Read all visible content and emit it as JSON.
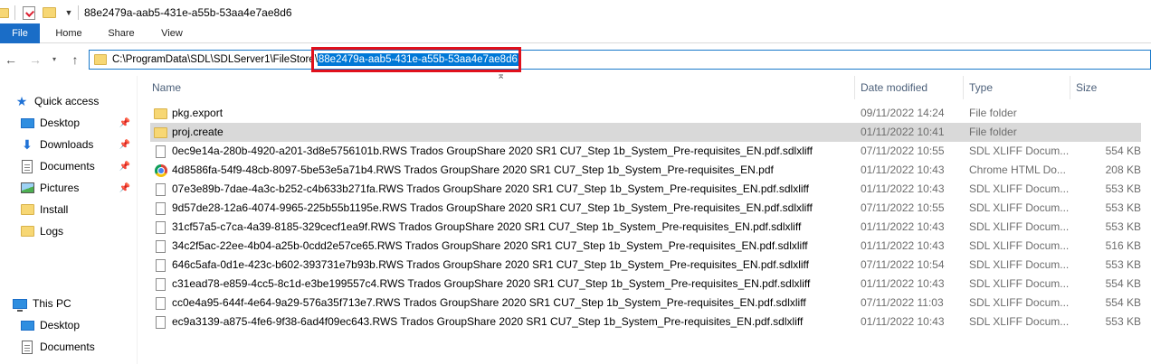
{
  "titlebar": {
    "title": "88e2479a-aab5-431e-a55b-53aa4e7ae8d6",
    "icons": [
      "folder-icon",
      "properties-icon",
      "new-folder-icon",
      "customize-dropdown-icon"
    ]
  },
  "ribbon": {
    "tabs": [
      {
        "label": "File"
      },
      {
        "label": "Home"
      },
      {
        "label": "Share"
      },
      {
        "label": "View"
      }
    ]
  },
  "address": {
    "path_prefix": "C:\\ProgramData\\SDL\\SDLServer1\\FileStore\\",
    "path_selected": "88e2479a-aab5-431e-a55b-53aa4e7ae8d6",
    "highlight_color": "#e0101c"
  },
  "sidebar": {
    "quick_access": "Quick access",
    "items": [
      {
        "label": "Desktop",
        "icon": "desktop-icon",
        "pinned": true
      },
      {
        "label": "Downloads",
        "icon": "download-icon",
        "pinned": true
      },
      {
        "label": "Documents",
        "icon": "documents-icon",
        "pinned": true
      },
      {
        "label": "Pictures",
        "icon": "pictures-icon",
        "pinned": true
      },
      {
        "label": "Install",
        "icon": "folder-icon",
        "pinned": false
      },
      {
        "label": "Logs",
        "icon": "folder-icon",
        "pinned": false
      }
    ],
    "this_pc": "This PC",
    "pc_items": [
      {
        "label": "Desktop",
        "icon": "desktop-icon"
      },
      {
        "label": "Documents",
        "icon": "documents-icon"
      }
    ]
  },
  "columns": {
    "name": "Name",
    "date": "Date modified",
    "type": "Type",
    "size": "Size"
  },
  "files": [
    {
      "name": "pkg.export",
      "date": "09/11/2022 14:24",
      "type": "File folder",
      "size": "",
      "icon": "folder-icon"
    },
    {
      "name": "proj.create",
      "date": "01/11/2022 10:41",
      "type": "File folder",
      "size": "",
      "icon": "folder-icon",
      "selected": true
    },
    {
      "name": "0ec9e14a-280b-4920-a201-3d8e5756101b.RWS Trados GroupShare 2020 SR1 CU7_Step 1b_System_Pre-requisites_EN.pdf.sdlxliff",
      "date": "07/11/2022 10:55",
      "type": "SDL XLIFF Docum...",
      "size": "554 KB",
      "icon": "file-icon"
    },
    {
      "name": "4d8586fa-54f9-48cb-8097-5be53e5a71b4.RWS Trados GroupShare 2020 SR1 CU7_Step 1b_System_Pre-requisites_EN.pdf",
      "date": "01/11/2022 10:43",
      "type": "Chrome HTML Do...",
      "size": "208 KB",
      "icon": "chrome-icon"
    },
    {
      "name": "07e3e89b-7dae-4a3c-b252-c4b633b271fa.RWS Trados GroupShare 2020 SR1 CU7_Step 1b_System_Pre-requisites_EN.pdf.sdlxliff",
      "date": "01/11/2022 10:43",
      "type": "SDL XLIFF Docum...",
      "size": "553 KB",
      "icon": "file-icon"
    },
    {
      "name": "9d57de28-12a6-4074-9965-225b55b1195e.RWS Trados GroupShare 2020 SR1 CU7_Step 1b_System_Pre-requisites_EN.pdf.sdlxliff",
      "date": "07/11/2022 10:55",
      "type": "SDL XLIFF Docum...",
      "size": "553 KB",
      "icon": "file-icon"
    },
    {
      "name": "31cf57a5-c7ca-4a39-8185-329cecf1ea9f.RWS Trados GroupShare 2020 SR1 CU7_Step 1b_System_Pre-requisites_EN.pdf.sdlxliff",
      "date": "01/11/2022 10:43",
      "type": "SDL XLIFF Docum...",
      "size": "553 KB",
      "icon": "file-icon"
    },
    {
      "name": "34c2f5ac-22ee-4b04-a25b-0cdd2e57ce65.RWS Trados GroupShare 2020 SR1 CU7_Step 1b_System_Pre-requisites_EN.pdf.sdlxliff",
      "date": "01/11/2022 10:43",
      "type": "SDL XLIFF Docum...",
      "size": "516 KB",
      "icon": "file-icon"
    },
    {
      "name": "646c5afa-0d1e-423c-b602-393731e7b93b.RWS Trados GroupShare 2020 SR1 CU7_Step 1b_System_Pre-requisites_EN.pdf.sdlxliff",
      "date": "07/11/2022 10:54",
      "type": "SDL XLIFF Docum...",
      "size": "553 KB",
      "icon": "file-icon"
    },
    {
      "name": "c31ead78-e859-4cc5-8c1d-e3be199557c4.RWS Trados GroupShare 2020 SR1 CU7_Step 1b_System_Pre-requisites_EN.pdf.sdlxliff",
      "date": "01/11/2022 10:43",
      "type": "SDL XLIFF Docum...",
      "size": "554 KB",
      "icon": "file-icon"
    },
    {
      "name": "cc0e4a95-644f-4e64-9a29-576a35f713e7.RWS Trados GroupShare 2020 SR1 CU7_Step 1b_System_Pre-requisites_EN.pdf.sdlxliff",
      "date": "07/11/2022 11:03",
      "type": "SDL XLIFF Docum...",
      "size": "554 KB",
      "icon": "file-icon"
    },
    {
      "name": "ec9a3139-a875-4fe6-9f38-6ad4f09ec643.RWS Trados GroupShare 2020 SR1 CU7_Step 1b_System_Pre-requisites_EN.pdf.sdlxliff",
      "date": "01/11/2022 10:43",
      "type": "SDL XLIFF Docum...",
      "size": "553 KB",
      "icon": "file-icon"
    }
  ]
}
